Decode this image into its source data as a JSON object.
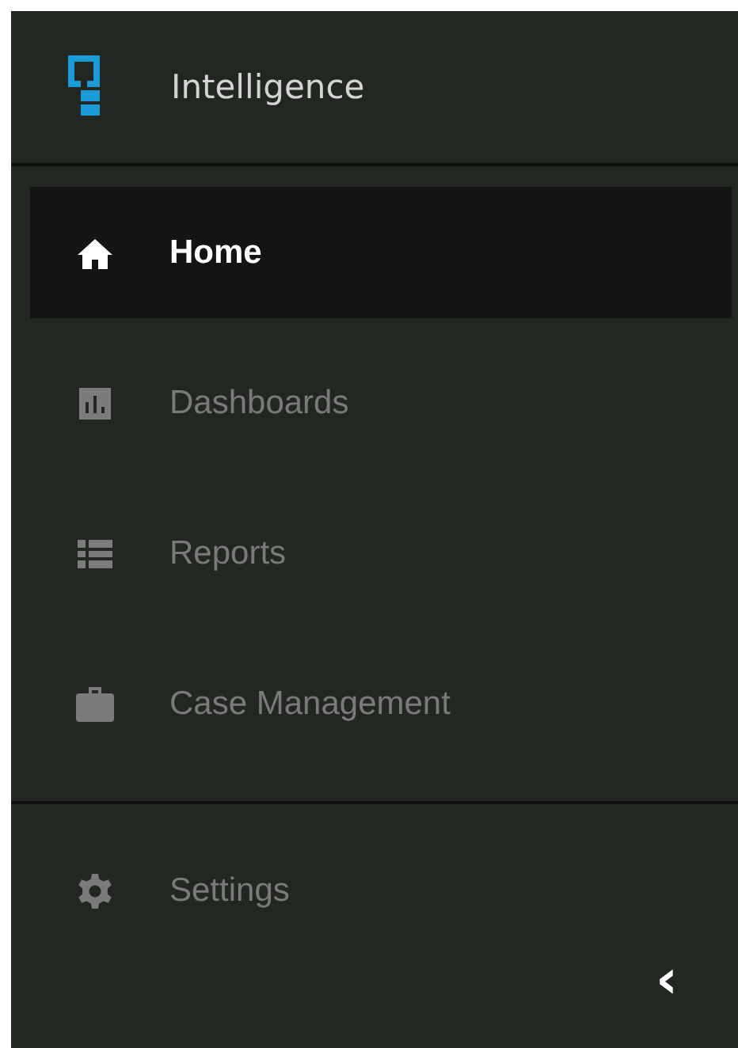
{
  "header": {
    "title": "Intelligence"
  },
  "nav_items": [
    {
      "label": "Home",
      "kind": "home",
      "selected": true
    },
    {
      "label": "Dashboards",
      "kind": "chart",
      "selected": false
    },
    {
      "label": "Reports",
      "kind": "list",
      "selected": false
    },
    {
      "label": "Case Management",
      "kind": "briefcase",
      "selected": false
    }
  ],
  "footer_items": [
    {
      "label": "Settings",
      "kind": "gear",
      "selected": false
    }
  ],
  "collapse_button": {
    "symbol": "‹"
  }
}
